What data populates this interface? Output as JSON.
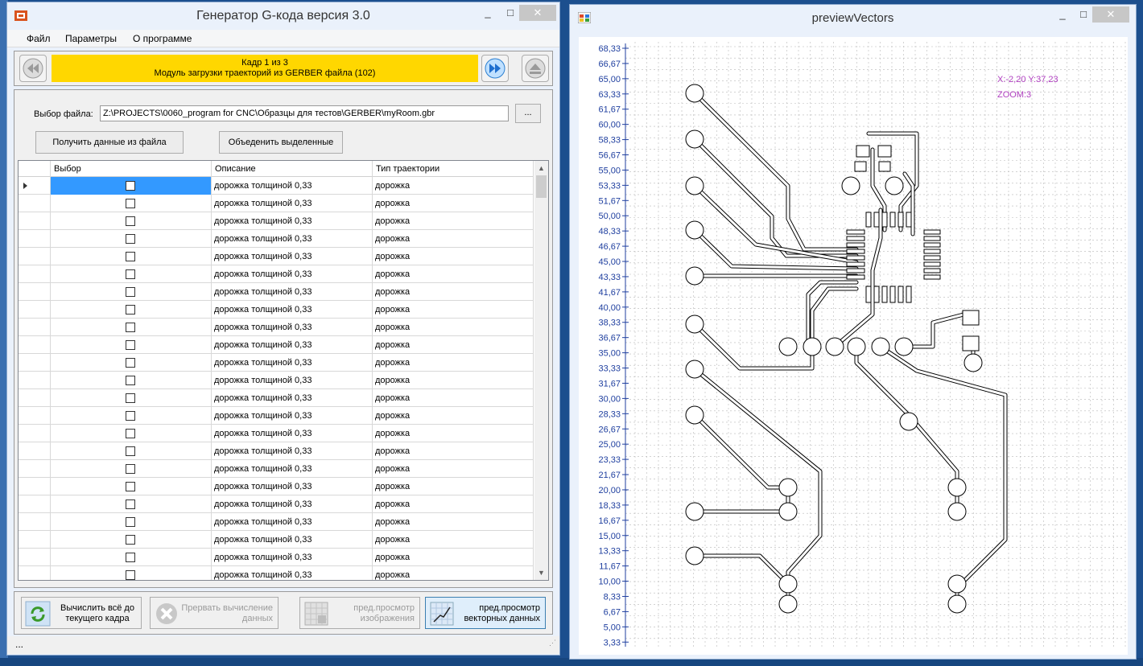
{
  "left_window": {
    "title": "Генератор G-кода версия 3.0",
    "caption": {
      "minimize": "_",
      "maximize": "□",
      "close": "✕"
    },
    "menu": [
      "Файл",
      "Параметры",
      "О программе"
    ],
    "frame_line1": "Кадр 1 из 3",
    "frame_line2": "Модуль загрузки траекторий из GERBER файла (102)",
    "file_label": "Выбор файла:",
    "file_path": "Z:\\PROJECTS\\0060_program for CNC\\Образцы для тестов\\GERBER\\myRoom.gbr",
    "browse_label": "...",
    "get_data_label": "Получить данные из файла",
    "merge_label": "Объеденить выделенные",
    "grid_headers": [
      "Выбор",
      "Описание",
      "Тип траектории"
    ],
    "grid_rows": [
      {
        "desc": "дорожка толщиной 0,33",
        "type": "дорожка"
      },
      {
        "desc": "дорожка толщиной 0,33",
        "type": "дорожка"
      },
      {
        "desc": "дорожка толщиной 0,33",
        "type": "дорожка"
      },
      {
        "desc": "дорожка толщиной 0,33",
        "type": "дорожка"
      },
      {
        "desc": "дорожка толщиной 0,33",
        "type": "дорожка"
      },
      {
        "desc": "дорожка толщиной 0,33",
        "type": "дорожка"
      },
      {
        "desc": "дорожка толщиной 0,33",
        "type": "дорожка"
      },
      {
        "desc": "дорожка толщиной 0,33",
        "type": "дорожка"
      },
      {
        "desc": "дорожка толщиной 0,33",
        "type": "дорожка"
      },
      {
        "desc": "дорожка толщиной 0,33",
        "type": "дорожка"
      },
      {
        "desc": "дорожка толщиной 0,33",
        "type": "дорожка"
      },
      {
        "desc": "дорожка толщиной 0,33",
        "type": "дорожка"
      },
      {
        "desc": "дорожка толщиной 0,33",
        "type": "дорожка"
      },
      {
        "desc": "дорожка толщиной 0,33",
        "type": "дорожка"
      },
      {
        "desc": "дорожка толщиной 0,33",
        "type": "дорожка"
      },
      {
        "desc": "дорожка толщиной 0,33",
        "type": "дорожка"
      },
      {
        "desc": "дорожка толщиной 0,33",
        "type": "дорожка"
      },
      {
        "desc": "дорожка толщиной 0,33",
        "type": "дорожка"
      },
      {
        "desc": "дорожка толщиной 0,33",
        "type": "дорожка"
      },
      {
        "desc": "дорожка толщиной 0,33",
        "type": "дорожка"
      },
      {
        "desc": "дорожка толщиной 0,33",
        "type": "дорожка"
      },
      {
        "desc": "дорожка толщиной 0,33",
        "type": "дорожка"
      },
      {
        "desc": "дорожка толщиной 0,33",
        "type": "дорожка"
      },
      {
        "desc": "дорожка толщиной 0,33",
        "type": "дорожка"
      }
    ],
    "btn_calc": "Вычислить всё до текущего кадра",
    "btn_stop": "Прервать вычисление данных",
    "btn_preview_img": "пред.просмотр изображения",
    "btn_preview_vec": "пред.просмотр векторных данных",
    "status": "..."
  },
  "right_window": {
    "title": "previewVectors",
    "caption": {
      "minimize": "_",
      "maximize": "□",
      "close": "✕"
    },
    "coords": "X:-2,20 Y:37,23",
    "zoom": "ZOOM:3",
    "y_ticks": [
      "68,33",
      "66,67",
      "65,00",
      "63,33",
      "61,67",
      "60,00",
      "58,33",
      "56,67",
      "55,00",
      "53,33",
      "51,67",
      "50,00",
      "48,33",
      "46,67",
      "45,00",
      "43,33",
      "41,67",
      "40,00",
      "38,33",
      "36,67",
      "35,00",
      "33,33",
      "31,67",
      "30,00",
      "28,33",
      "26,67",
      "25,00",
      "23,33",
      "21,67",
      "20,00",
      "18,33",
      "16,67",
      "15,00",
      "13,33",
      "11,67",
      "10,00",
      "8,33",
      "6,67",
      "5,00",
      "3,33"
    ],
    "axis_color": "#1f3f9f",
    "label_color": "#b040c0"
  }
}
